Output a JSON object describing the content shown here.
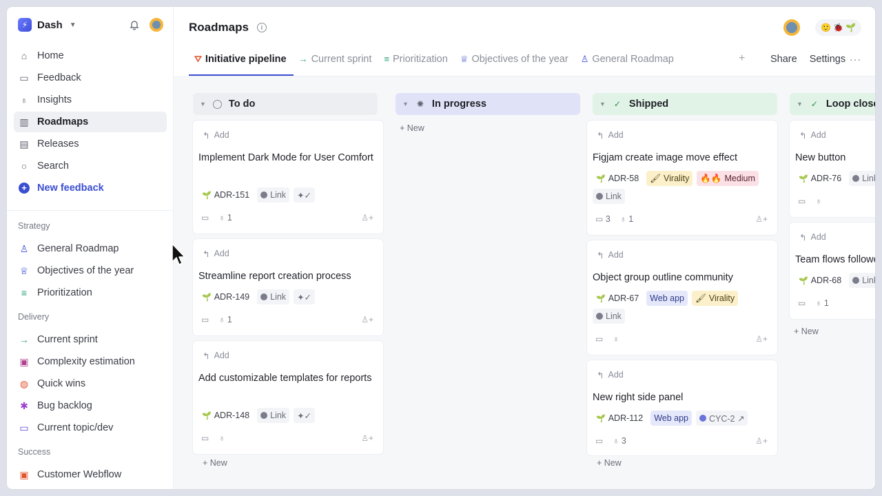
{
  "workspace": {
    "name": "Dash"
  },
  "nav": [
    {
      "label": "Home",
      "icon": "home-icon"
    },
    {
      "label": "Feedback",
      "icon": "inbox-icon"
    },
    {
      "label": "Insights",
      "icon": "lightbulb-icon"
    },
    {
      "label": "Roadmaps",
      "icon": "map-icon",
      "active": true
    },
    {
      "label": "Releases",
      "icon": "document-icon"
    },
    {
      "label": "Search",
      "icon": "search-icon"
    },
    {
      "label": "New feedback",
      "icon": "plus-circle-icon"
    }
  ],
  "sections": {
    "strategy": {
      "label": "Strategy",
      "items": [
        "General Roadmap",
        "Objectives of the year",
        "Prioritization"
      ]
    },
    "delivery": {
      "label": "Delivery",
      "items": [
        "Current sprint",
        "Complexity estimation",
        "Quick wins",
        "Bug backlog",
        "Current topic/dev"
      ]
    },
    "success": {
      "label": "Success",
      "items": [
        "Customer Webflow"
      ]
    }
  },
  "header": {
    "title": "Roadmaps",
    "share": "Share",
    "settings": "Settings"
  },
  "tabs": [
    {
      "label": "Initiative pipeline",
      "active": true
    },
    {
      "label": "Current sprint"
    },
    {
      "label": "Prioritization"
    },
    {
      "label": "Objectives of the year"
    },
    {
      "label": "General Roadmap"
    }
  ],
  "board": {
    "add_label": "Add",
    "new_label": "+ New",
    "columns": [
      {
        "title": "To do",
        "cards": [
          {
            "title": "Implement Dark Mode for User Comfort",
            "id": "ADR-151",
            "link": "Link",
            "insights": "1"
          },
          {
            "title": "Streamline report creation process",
            "id": "ADR-149",
            "link": "Link",
            "insights": "1"
          },
          {
            "title": "Add customizable templates for reports",
            "id": "ADR-148",
            "link": "Link"
          }
        ]
      },
      {
        "title": "In progress",
        "cards": []
      },
      {
        "title": "Shipped",
        "cards": [
          {
            "title": "Figjam create image move effect",
            "id": "ADR-58",
            "tags": [
              "Virality",
              "Medium"
            ],
            "link": "Link",
            "comments": "3",
            "insights": "1"
          },
          {
            "title": "Object group outline community",
            "id": "ADR-67",
            "tags": [
              "Web app",
              "Virality"
            ],
            "link": "Link"
          },
          {
            "title": "New right side panel",
            "id": "ADR-112",
            "tags": [
              "Web app",
              "CYC-2 ↗"
            ],
            "insights": "3"
          }
        ]
      },
      {
        "title": "Loop closed",
        "cards": [
          {
            "title": "New button",
            "id": "ADR-76",
            "link": "Link"
          },
          {
            "title": "Team flows followe",
            "id": "ADR-68",
            "link": "Link",
            "insights": "1"
          }
        ]
      }
    ]
  },
  "colors": {
    "accent": "#3a4ed1",
    "todo": "#eceef2",
    "progress": "#e0e3f7",
    "shipped": "#e1f3e7"
  }
}
